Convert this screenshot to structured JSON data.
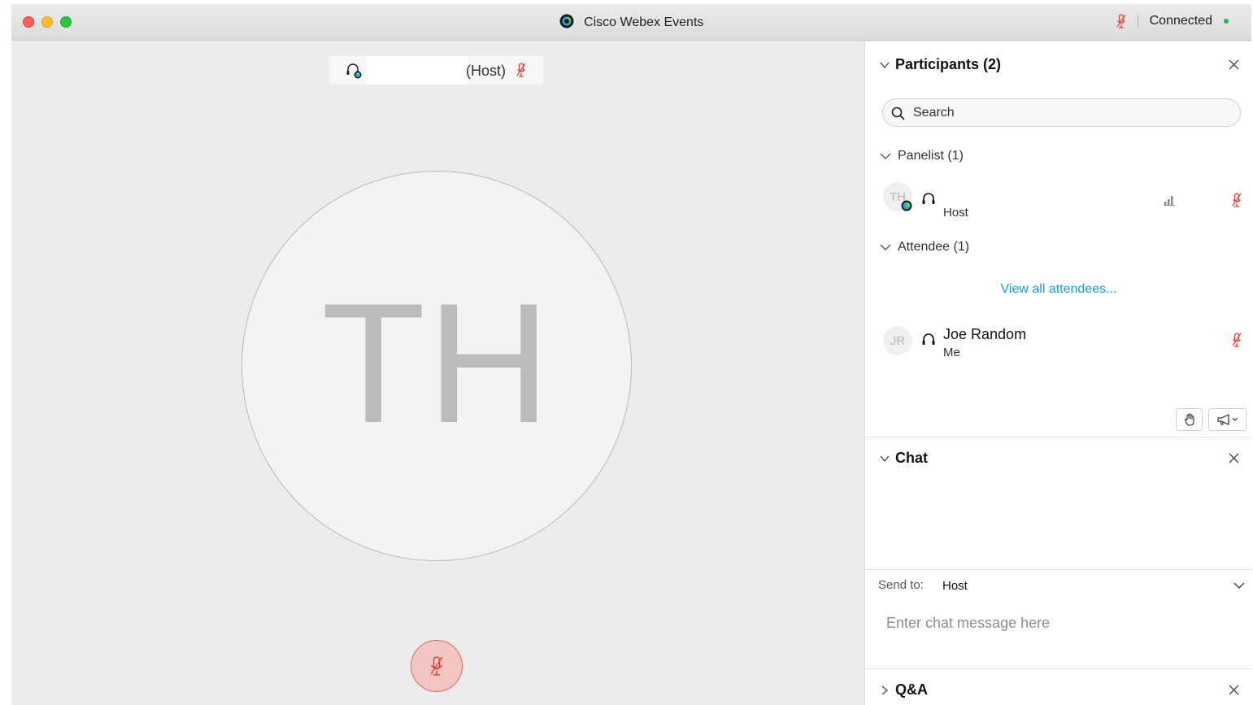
{
  "window": {
    "title": "Cisco Webex Events",
    "status_text": "Connected",
    "status_separator": "|"
  },
  "stage": {
    "speaker_role": "(Host)",
    "avatar_initials": "TH"
  },
  "participants": {
    "title": "Participants (2)",
    "search_placeholder": "Search",
    "panelist_group": "Panelist (1)",
    "attendee_group": "Attendee (1)",
    "panelist": {
      "initials": "TH",
      "role": "Host"
    },
    "view_all": "View all attendees...",
    "attendee": {
      "initials": "JR",
      "name": "Joe Random",
      "sub": "Me"
    }
  },
  "chat": {
    "title": "Chat",
    "send_to_label": "Send to:",
    "send_to_value": "Host",
    "input_placeholder": "Enter chat message here"
  },
  "qa": {
    "title": "Q&A"
  },
  "colors": {
    "mute_red": "#e0443e",
    "link_blue": "#1a9ad6",
    "connected_green": "#2bb24c"
  }
}
